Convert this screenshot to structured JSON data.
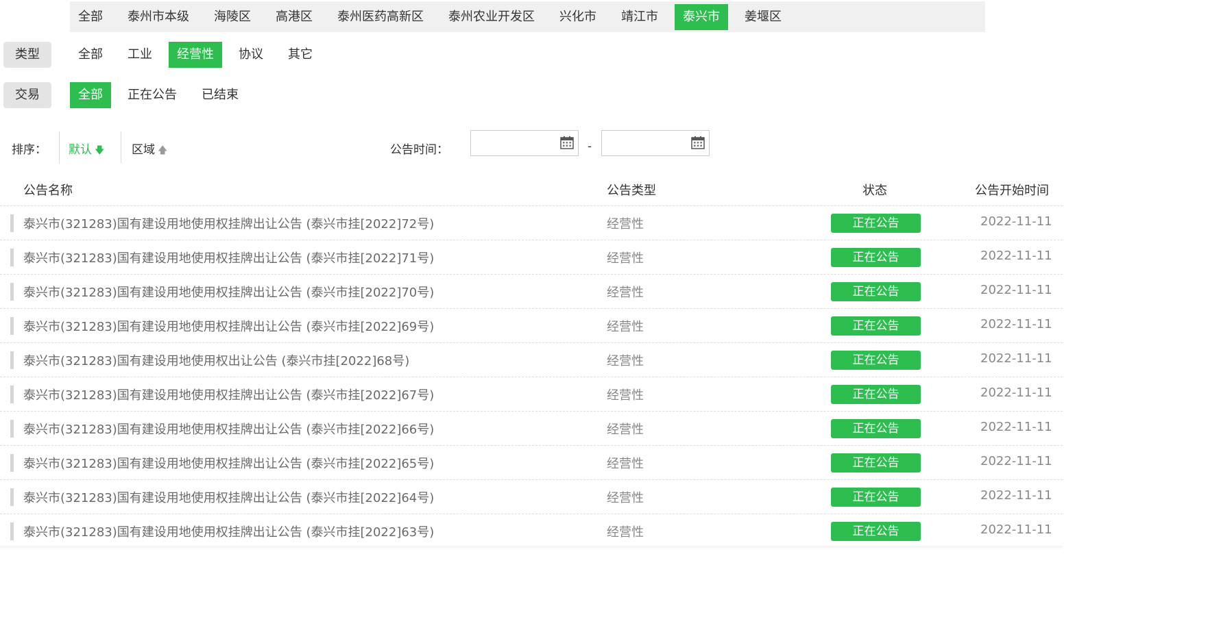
{
  "regions": [
    "全部",
    "泰州市本级",
    "海陵区",
    "高港区",
    "泰州医药高新区",
    "泰州农业开发区",
    "兴化市",
    "靖江市",
    "泰兴市",
    "姜堰区"
  ],
  "regions_active": "泰兴市",
  "type_filter": {
    "label": "类型",
    "options": [
      "全部",
      "工业",
      "经营性",
      "协议",
      "其它"
    ],
    "active": "经营性"
  },
  "trade_filter": {
    "label": "交易",
    "options": [
      "全部",
      "正在公告",
      "已结束"
    ],
    "active": "全部"
  },
  "sort": {
    "label": "排序：",
    "default_label": "默认",
    "region_label": "区域",
    "time_label": "公告时间：",
    "date_separator": "-",
    "start_date": "",
    "end_date": ""
  },
  "table": {
    "columns": {
      "name": "公告名称",
      "type": "公告类型",
      "status": "状态",
      "start_time": "公告开始时间"
    },
    "rows": [
      {
        "title": "泰兴市(321283)国有建设用地使用权挂牌出让公告 (泰兴市挂[2022]72号)",
        "type": "经营性",
        "status": "正在公告",
        "date": "2022-11-11"
      },
      {
        "title": "泰兴市(321283)国有建设用地使用权挂牌出让公告 (泰兴市挂[2022]71号)",
        "type": "经营性",
        "status": "正在公告",
        "date": "2022-11-11"
      },
      {
        "title": "泰兴市(321283)国有建设用地使用权挂牌出让公告 (泰兴市挂[2022]70号)",
        "type": "经营性",
        "status": "正在公告",
        "date": "2022-11-11"
      },
      {
        "title": "泰兴市(321283)国有建设用地使用权挂牌出让公告 (泰兴市挂[2022]69号)",
        "type": "经营性",
        "status": "正在公告",
        "date": "2022-11-11"
      },
      {
        "title": "泰兴市(321283)国有建设用地使用权出让公告 (泰兴市挂[2022]68号)",
        "type": "经营性",
        "status": "正在公告",
        "date": "2022-11-11"
      },
      {
        "title": "泰兴市(321283)国有建设用地使用权挂牌出让公告 (泰兴市挂[2022]67号)",
        "type": "经营性",
        "status": "正在公告",
        "date": "2022-11-11"
      },
      {
        "title": "泰兴市(321283)国有建设用地使用权挂牌出让公告 (泰兴市挂[2022]66号)",
        "type": "经营性",
        "status": "正在公告",
        "date": "2022-11-11"
      },
      {
        "title": "泰兴市(321283)国有建设用地使用权挂牌出让公告 (泰兴市挂[2022]65号)",
        "type": "经营性",
        "status": "正在公告",
        "date": "2022-11-11"
      },
      {
        "title": "泰兴市(321283)国有建设用地使用权挂牌出让公告 (泰兴市挂[2022]64号)",
        "type": "经营性",
        "status": "正在公告",
        "date": "2022-11-11"
      },
      {
        "title": "泰兴市(321283)国有建设用地使用权挂牌出让公告 (泰兴市挂[2022]63号)",
        "type": "经营性",
        "status": "正在公告",
        "date": "2022-11-11"
      }
    ]
  },
  "colors": {
    "accent_green": "#2dbe4f",
    "label_bg": "#e4e4e4",
    "region_bar_bg": "#f0f0f0"
  },
  "icons": {
    "sort_default": "arrow-down-icon",
    "sort_region": "arrow-up-icon",
    "date_picker": "calendar-icon"
  }
}
